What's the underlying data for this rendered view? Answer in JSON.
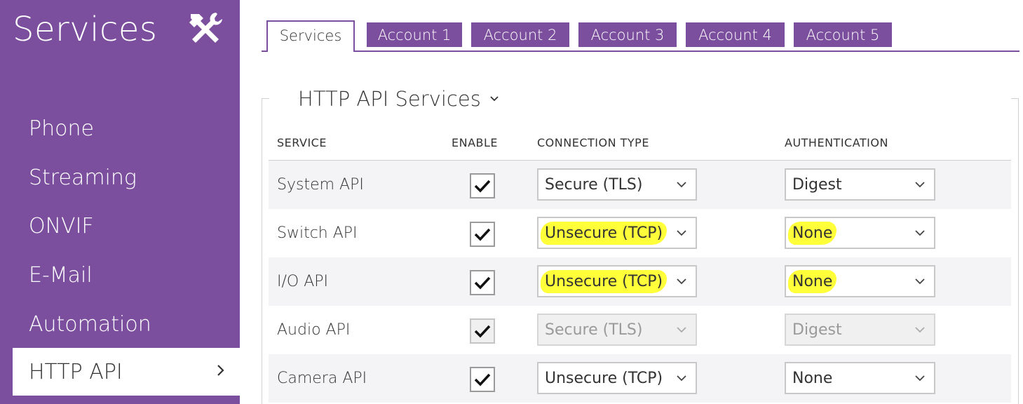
{
  "sidebar": {
    "title": "Services",
    "tools_icon": "hammer-wrench-icon",
    "items": [
      {
        "label": "Phone"
      },
      {
        "label": "Streaming"
      },
      {
        "label": "ONVIF"
      },
      {
        "label": "E-Mail"
      },
      {
        "label": "Automation"
      },
      {
        "label": "HTTP API",
        "active": true
      }
    ]
  },
  "tabs": [
    {
      "label": "Services",
      "active": true
    },
    {
      "label": "Account 1"
    },
    {
      "label": "Account 2"
    },
    {
      "label": "Account 3"
    },
    {
      "label": "Account 4"
    },
    {
      "label": "Account 5"
    }
  ],
  "section": {
    "title": "HTTP API Services",
    "expand_icon": "chevron-down-icon"
  },
  "columns": {
    "service": "SERVICE",
    "enable": "ENABLE",
    "connection": "CONNECTION TYPE",
    "authentication": "AUTHENTICATION"
  },
  "rows": [
    {
      "service": "System API",
      "enabled": true,
      "connection": "Secure (TLS)",
      "authentication": "Digest",
      "disabled": false,
      "highlight": false
    },
    {
      "service": "Switch API",
      "enabled": true,
      "connection": "Unsecure (TCP)",
      "authentication": "None",
      "disabled": false,
      "highlight": true
    },
    {
      "service": "I/O API",
      "enabled": true,
      "connection": "Unsecure (TCP)",
      "authentication": "None",
      "disabled": false,
      "highlight": true
    },
    {
      "service": "Audio API",
      "enabled": true,
      "connection": "Secure (TLS)",
      "authentication": "Digest",
      "disabled": true,
      "highlight": false
    },
    {
      "service": "Camera API",
      "enabled": true,
      "connection": "Unsecure (TCP)",
      "authentication": "None",
      "disabled": false,
      "highlight": false
    }
  ],
  "colors": {
    "brand_purple": "#7b4f9e",
    "highlight_yellow": "#ffff3a",
    "row_shade": "#f4f4f7"
  }
}
